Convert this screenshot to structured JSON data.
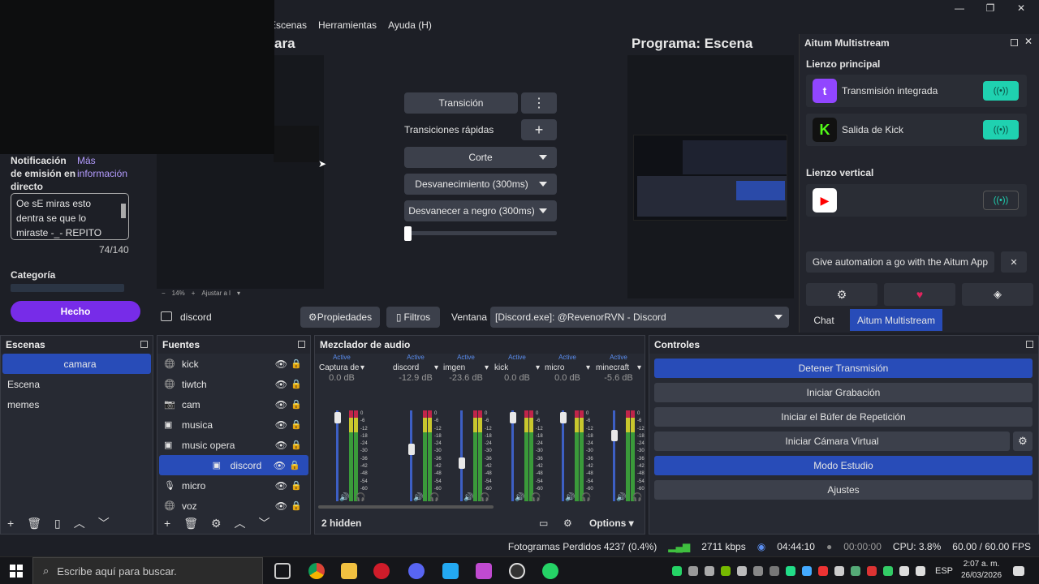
{
  "menu": [
    "Escenas",
    "Herramientas",
    "Ayuda (H)"
  ],
  "window_controls": {
    "minimize": "—",
    "maximize": "❐",
    "close": "✕"
  },
  "preview": {
    "title_fragment": "ara",
    "zoom": "14%",
    "adjust": "Ajustar a l"
  },
  "program": {
    "title": "Programa: Escena"
  },
  "transition": {
    "button": "Transición",
    "quick_label": "Transiciones rápidas",
    "options": [
      "Corte",
      "Desvanecimiento (300ms)",
      "Desvanecer a negro (300ms)"
    ]
  },
  "notification": {
    "label_line1": "Notificación",
    "label_line2": "de emisión en",
    "label_line3": "directo",
    "more_link_line1": "Más",
    "more_link_line2": "información",
    "text": "Oe sE miras esto dentra se que lo miraste -_- REPITO",
    "counter": "74/140",
    "category_label": "Categoría",
    "done_button": "Hecho"
  },
  "aitum": {
    "title": "Aitum Multistream",
    "main_canvas": "Lienzo principal",
    "vertical_canvas": "Lienzo vertical",
    "outputs": [
      {
        "name": "Transmisión integrada",
        "color": "#9146ff",
        "active": true
      },
      {
        "name": "Salida de Kick",
        "color": "#1a1a1a",
        "active": true
      },
      {
        "name": "",
        "color": "#ffffff",
        "active": false
      }
    ],
    "promo": "Give automation a go with the Aitum App",
    "promo_close": "✕",
    "tabs": [
      "Chat",
      "Aitum Multistream"
    ]
  },
  "source_toolbar": {
    "source": "discord",
    "properties": "Propiedades",
    "filters": "Filtros",
    "window_label": "Ventana",
    "window_value": "[Discord.exe]: @RevenorRVN - Discord"
  },
  "scenes": {
    "title": "Escenas",
    "items": [
      "camara",
      "Escena",
      "memes"
    ],
    "selected": 0
  },
  "sources": {
    "title": "Fuentes",
    "items": [
      {
        "name": "kick",
        "icon": "browser-icon"
      },
      {
        "name": "tiwtch",
        "icon": "browser-icon"
      },
      {
        "name": "cam",
        "icon": "camera-icon"
      },
      {
        "name": "musica",
        "icon": "audio-icon"
      },
      {
        "name": "music opera",
        "icon": "audio-icon"
      },
      {
        "name": "discord",
        "icon": "window-icon"
      },
      {
        "name": "micro",
        "icon": "mic-icon"
      },
      {
        "name": "voz",
        "icon": "browser-icon"
      }
    ],
    "selected": 5
  },
  "mixer": {
    "title": "Mezclador de audio",
    "channels": [
      {
        "status": "Active",
        "name": "Captura de juego",
        "db": "0.0 dB",
        "level": 0.95
      },
      {
        "status": "Active",
        "name": "discord",
        "db": "-12.9 dB",
        "level": 0.6
      },
      {
        "status": "Active",
        "name": "imgen",
        "db": "-23.6 dB",
        "level": 0.45
      },
      {
        "status": "Active",
        "name": "kick",
        "db": "0.0 dB",
        "level": 0.95
      },
      {
        "status": "Active",
        "name": "micro",
        "db": "0.0 dB",
        "level": 0.95
      },
      {
        "status": "Active",
        "name": "minecraft",
        "db": "-5.6 dB",
        "level": 0.75
      }
    ],
    "scale": [
      "0",
      "-6",
      "-12",
      "-18",
      "-24",
      "-30",
      "-36",
      "-42",
      "-48",
      "-54",
      "-60"
    ],
    "hidden": "2 hidden",
    "options": "Options"
  },
  "controls": {
    "title": "Controles",
    "buttons": [
      "Detener Transmisión",
      "Iniciar Grabación",
      "Iniciar el Búfer de Repetición",
      "Iniciar Cámara Virtual",
      "Modo Estudio",
      "Ajustes"
    ]
  },
  "status": {
    "dropped": "Fotogramas Perdidos 4237 (0.4%)",
    "bitrate": "2711 kbps",
    "live_time": "04:44:10",
    "rec_time": "00:00:00",
    "cpu": "CPU: 3.8%",
    "fps": "60.00 / 60.00 FPS"
  },
  "taskbar": {
    "search": "Escribe aquí para buscar.",
    "lang": "ESP",
    "time": "2:07 a. m.",
    "date": "26/03/2026"
  }
}
